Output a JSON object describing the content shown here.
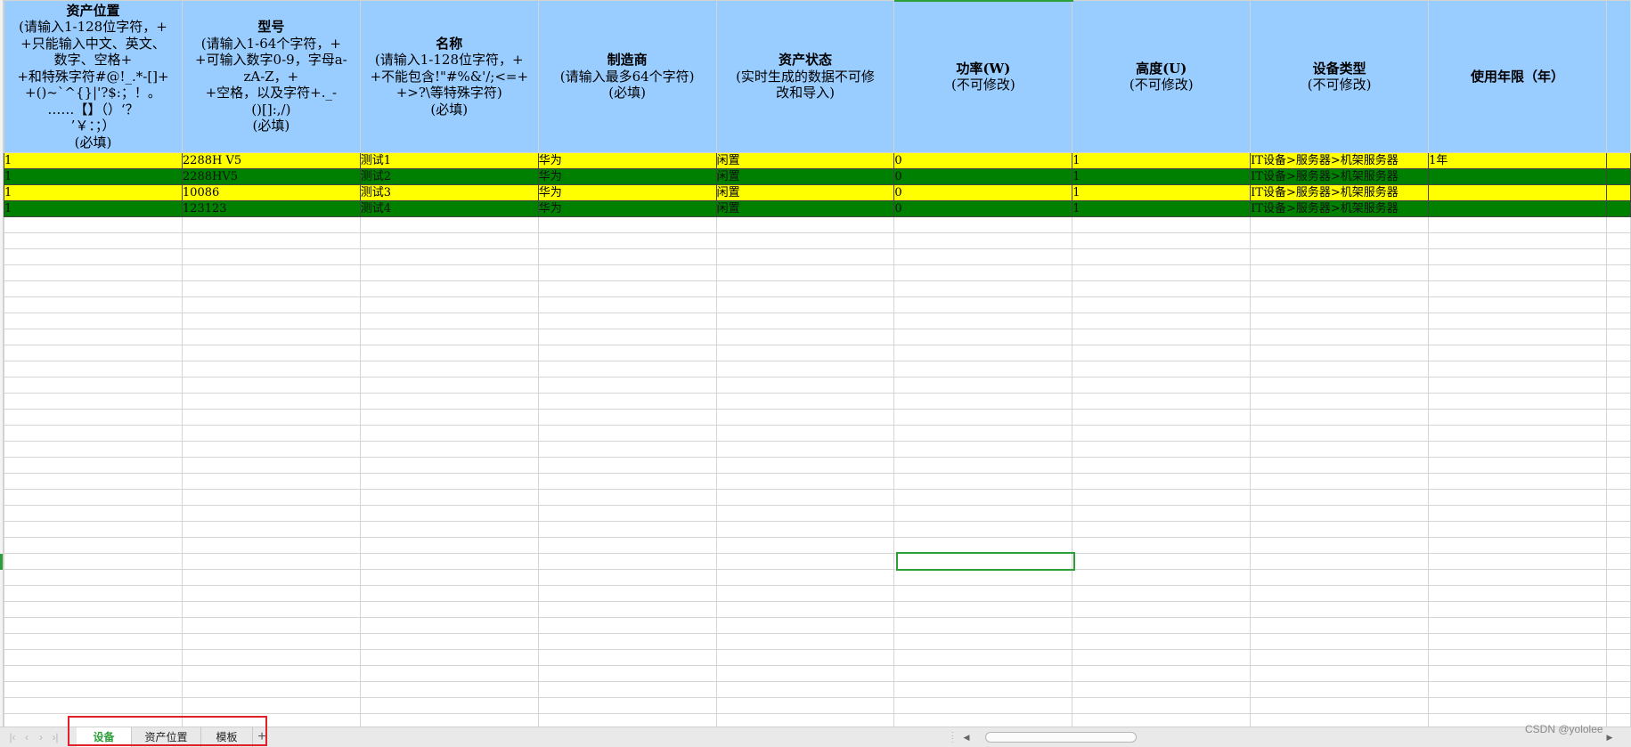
{
  "spreadsheet": {
    "columns": [
      {
        "header_title": "资产位置",
        "header_desc": "(请输入1-128位字符，+\n+只能输入中文、英文、\n数字、空格+\n+和特殊字符#@!_.*-[]+\n+()~`^{}|'?$:；！。\n……【】（）‘？\n’￥：；）\n(必填)"
      },
      {
        "header_title": "型号",
        "header_desc": "(请输入1-64个字符，+\n+可输入数字0-9，字母a-\nzA-Z，+\n+空格，以及字符+._-\n()[]:,/)\n(必填)"
      },
      {
        "header_title": "名称",
        "header_desc": "(请输入1-128位字符，+\n+不能包含!\"#%&'/;<=+\n+>?\\等特殊字符)\n(必填)"
      },
      {
        "header_title": "制造商",
        "header_desc": "(请输入最多64个字符)\n(必填)"
      },
      {
        "header_title": "资产状态",
        "header_desc": "(实时生成的数据不可修\n改和导入)"
      },
      {
        "header_title": "功率(W)",
        "header_desc": "(不可修改)"
      },
      {
        "header_title": "高度(U)",
        "header_desc": "(不可修改)"
      },
      {
        "header_title": "设备类型",
        "header_desc": "(不可修改)"
      },
      {
        "header_title": "使用年限（年）",
        "header_desc": ""
      },
      {
        "header_title": "",
        "header_desc": ""
      }
    ],
    "rows": [
      {
        "highlight": "yellow",
        "cells": [
          "1",
          "2288H V5",
          "测试1",
          "华为",
          "闲置",
          "0",
          "1",
          "IT设备>服务器>机架服务器",
          "1年",
          ""
        ]
      },
      {
        "highlight": "green",
        "cells": [
          "1",
          "2288HV5",
          "测试2",
          "华为",
          "闲置",
          "0",
          "1",
          "IT设备>服务器>机架服务器",
          "",
          ""
        ]
      },
      {
        "highlight": "yellow",
        "cells": [
          "1",
          "10086",
          "测试3",
          "华为",
          "闲置",
          "0",
          "1",
          "IT设备>服务器>机架服务器",
          "",
          ""
        ]
      },
      {
        "highlight": "green",
        "cells": [
          "1",
          "123123",
          "测试4",
          "华为",
          "闲置",
          "0",
          "1",
          "IT设备>服务器>机架服务器",
          "",
          ""
        ]
      }
    ],
    "highlight_colors": {
      "yellow": "#ffff00",
      "green": "#008000",
      "header": "#99ccff",
      "selection": "#2e9e3a"
    }
  },
  "sheet_tabs": [
    {
      "label": "设备",
      "active": true
    },
    {
      "label": "资产位置",
      "active": false
    },
    {
      "label": "模板",
      "active": false
    }
  ],
  "add_sheet_label": "+",
  "nav_icons": [
    "first-sheet-icon",
    "prev-sheet-icon",
    "next-sheet-icon",
    "last-sheet-icon"
  ],
  "watermark": "CSDN @yololee"
}
